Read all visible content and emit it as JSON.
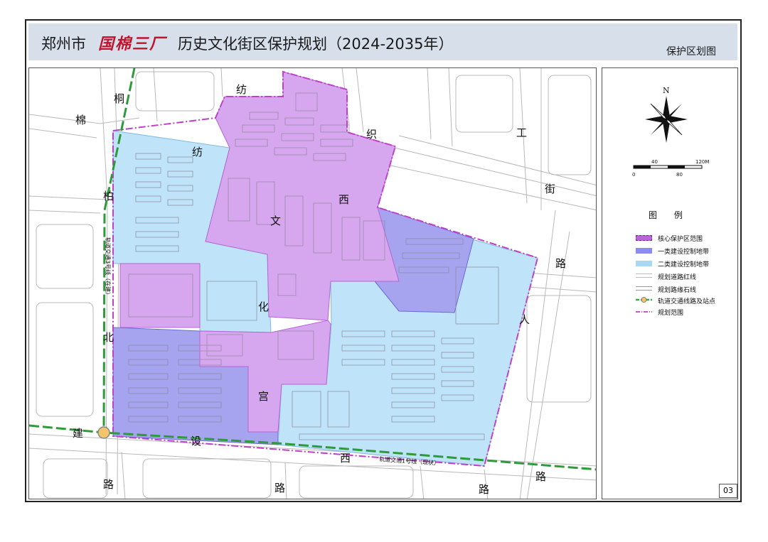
{
  "header": {
    "city": "郑州市",
    "brand": "国棉三厂",
    "title": "历史文化街区保护规划（2024-2035年）",
    "subtitle": "保护区划图"
  },
  "map": {
    "road_labels": {
      "tongbai_1": "桐",
      "tongbai_2": "柏",
      "tongbai_3": "北",
      "tongbai_4": "路",
      "mian_1": "棉",
      "fangzhi_1": "纺",
      "fangzhi_2": "织",
      "fangzhi_3": "纺",
      "gongren_1": "工",
      "gongren_2": "人",
      "jie": "街",
      "gongren_lu": "路",
      "wenhua_1": "西",
      "wenhua_2": "文",
      "wenhua_3": "化",
      "wenhua_4": "宫",
      "jianshe_1": "建",
      "jianshe_2": "设",
      "jianshe_3": "西",
      "jianshe_4": "路",
      "jianshe_lu_bottom": "路",
      "lu_bottom_1": "路",
      "lu_bottom_2": "路"
    },
    "metro_line_1": "轨道交通1号线（现状）",
    "metro_line_3": "轨道交通3号线（在建）"
  },
  "legend": {
    "north": "N",
    "scale_top_1": "40",
    "scale_top_2": "120M",
    "scale_bottom_0": "0",
    "scale_bottom_1": "80",
    "title": "图 例",
    "items": [
      {
        "label": "核心保护区范围",
        "color": "#b565d6"
      },
      {
        "label": "一类建设控制地带",
        "color": "#8a8cf0"
      },
      {
        "label": "二类建设控制地带",
        "color": "#a9d8f5"
      },
      {
        "label": "规划道路红线",
        "color": "#bbbbbb"
      },
      {
        "label": "规划路缘石线",
        "color": "#999999"
      },
      {
        "label": "轨道交通线路及站点",
        "color": "#3ea84a"
      },
      {
        "label": "规划范围",
        "color": "#d04fd0"
      }
    ]
  },
  "sheet_number": "03",
  "colors": {
    "core": "#d6a6ee",
    "class1": "#a6a3ef",
    "class2": "#bfe3f8",
    "metro": "#2e9b3a",
    "boundary": "#c040c8",
    "header_bg": "#d6dfea",
    "brand": "#c0132d"
  }
}
